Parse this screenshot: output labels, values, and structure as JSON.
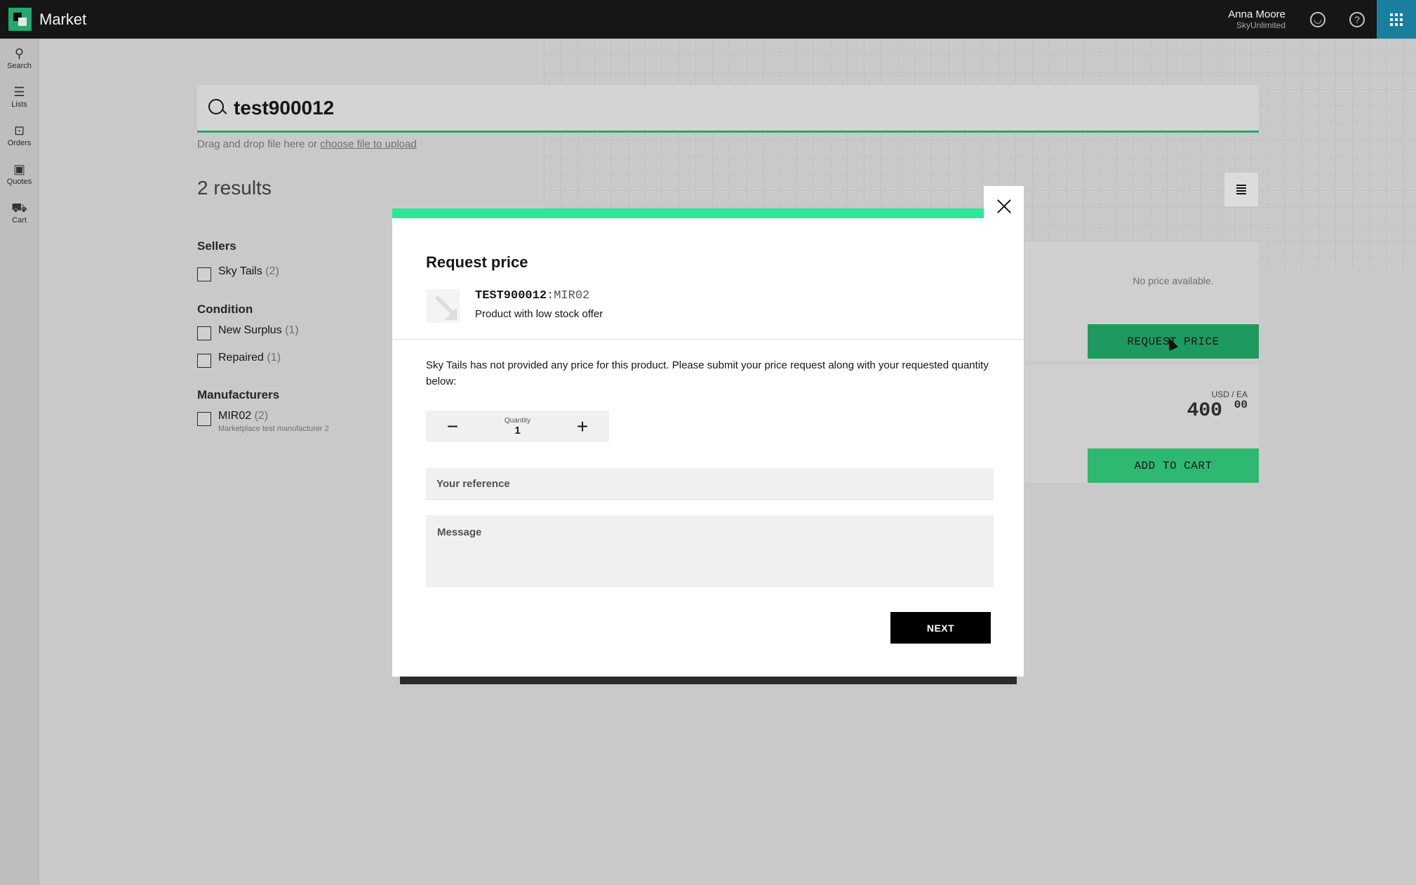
{
  "app": {
    "title": "Market"
  },
  "user": {
    "name": "Anna Moore",
    "org": "SkyUnlimited"
  },
  "leftnav": {
    "items": [
      {
        "label": "Search",
        "icon": "search-icon"
      },
      {
        "label": "Lists",
        "icon": "list-icon"
      },
      {
        "label": "Orders",
        "icon": "orders-icon"
      },
      {
        "label": "Quotes",
        "icon": "quotes-icon"
      },
      {
        "label": "Cart",
        "icon": "cart-icon"
      }
    ]
  },
  "search": {
    "value": "test900012",
    "upload_text": "Drag and drop file here or",
    "upload_link": "choose file to upload"
  },
  "results": {
    "count_label": "2 results"
  },
  "facets": {
    "sellers": {
      "title": "Sellers",
      "options": [
        {
          "label": "Sky Tails",
          "count": "(2)"
        }
      ]
    },
    "condition": {
      "title": "Condition",
      "options": [
        {
          "label": "New Surplus",
          "count": "(1)"
        },
        {
          "label": "Repaired",
          "count": "(1)"
        }
      ]
    },
    "manufacturers": {
      "title": "Manufacturers",
      "options": [
        {
          "label": "MIR02",
          "count": "(2)",
          "sub": "Marketplace test manufacturer 2"
        }
      ]
    }
  },
  "offers": {
    "no_price_text": "No price available.",
    "request_price_label": "REQUEST PRICE",
    "price_unit": "USD / EA",
    "price_main": "400",
    "price_cents": "00",
    "add_to_cart_label": "ADD TO CART"
  },
  "modal": {
    "title": "Request price",
    "product_code": "TEST900012",
    "product_separator": ":",
    "product_mfr": "MIR02",
    "product_name": "Product with low stock offer",
    "info": "Sky Tails has not provided any price for this product. Please submit your price request along with your requested quantity below:",
    "quantity_label": "Quantity",
    "quantity_value": "1",
    "reference_placeholder": "Your reference",
    "message_placeholder": "Message",
    "next_label": "NEXT"
  },
  "colors": {
    "accent_green": "#2ee59a",
    "button_green": "#1e9a60",
    "topbar": "#161616",
    "apps_blue": "#1a7f9e"
  }
}
